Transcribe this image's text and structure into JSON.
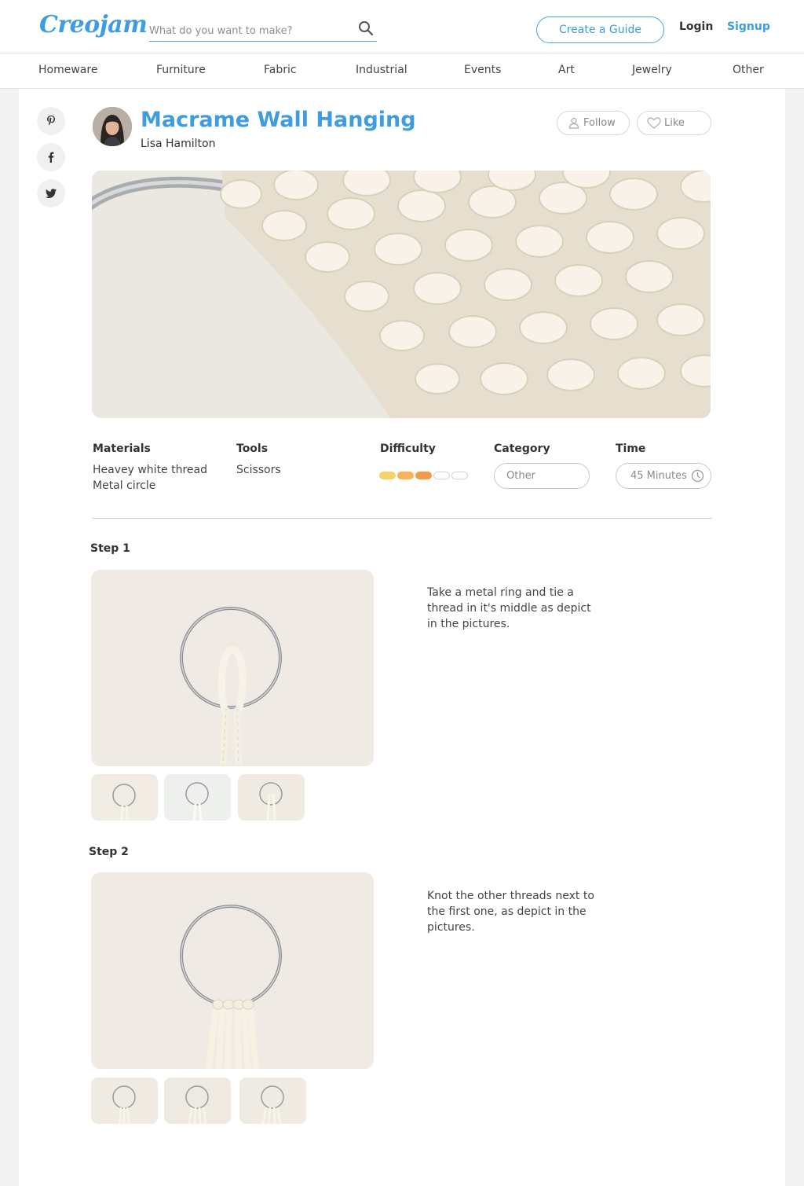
{
  "header": {
    "logo": "Creojam",
    "search_placeholder": "What do you want to make?",
    "create_label": "Create a Guide",
    "login_label": "Login",
    "signup_label": "Signup"
  },
  "nav": {
    "categories": [
      "Homeware",
      "Furniture",
      "Fabric",
      "Industrial",
      "Events",
      "Art",
      "Jewelry",
      "Other"
    ]
  },
  "social": [
    "pinterest-icon",
    "facebook-icon",
    "twitter-icon"
  ],
  "guide": {
    "title": "Macrame Wall Hanging",
    "author": "Lisa Hamilton",
    "follow_label": "Follow",
    "like_label": "Like"
  },
  "details": {
    "materials_label": "Materials",
    "materials": [
      "Heavey white thread",
      "Metal circle"
    ],
    "tools_label": "Tools",
    "tools": [
      "Scissors"
    ],
    "difficulty_label": "Difficulty",
    "difficulty_level": 3,
    "difficulty_max": 5,
    "difficulty_colors": [
      "#f7d26a",
      "#f5b45a",
      "#f49a4b"
    ],
    "category_label": "Category",
    "category_value": "Other",
    "time_label": "Time",
    "time_value": "45 Minutes"
  },
  "steps": [
    {
      "title": "Step 1",
      "text": "Take a metal ring and tie a thread in it's middle as depict in the pictures."
    },
    {
      "title": "Step 2",
      "text": "Knot the other threads next to the first one, as depict in the pictures."
    }
  ]
}
